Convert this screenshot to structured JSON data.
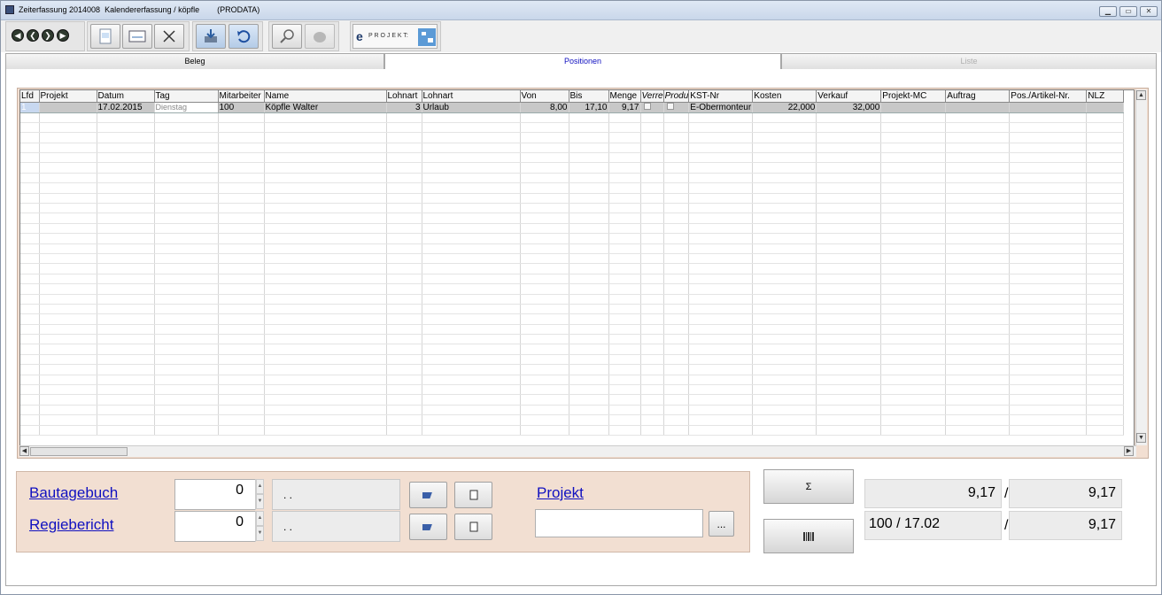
{
  "window": {
    "title": "Zeiterfassung 2014008  Kalendererfassung / köpfle        (PRODATA)",
    "controls": [
      "▁",
      "▭",
      "✕"
    ]
  },
  "toolbar": {
    "nav_glyphs": [
      "◀",
      "❮",
      "❯",
      "▶"
    ],
    "eprojekt_label": "P R O J E K T:",
    "eprojekt_e": "e"
  },
  "tabs": [
    {
      "label": "Beleg",
      "state": "normal"
    },
    {
      "label": "Positionen",
      "state": "active"
    },
    {
      "label": "Liste",
      "state": "disabled"
    }
  ],
  "grid": {
    "columns": [
      "Lfd",
      "Projekt",
      "Datum",
      "Tag",
      "Mitarbeiter",
      "Name",
      "Lohnart",
      "Lohnart",
      "Von",
      "Bis",
      "Menge",
      "Verre",
      "Produ",
      "KST-Nr",
      "Kosten",
      "Verkauf",
      "Projekt-MC",
      "Auftrag",
      "Pos./Artikel-Nr.",
      "NLZ"
    ],
    "italic_columns": [
      11,
      12
    ],
    "rows": [
      [
        "1",
        "",
        "17.02.2015",
        "Dienstag",
        "100",
        "Köpfle Walter",
        "3",
        "Urlaub",
        "8,00",
        "17,10",
        "9,17",
        "",
        "",
        "E-Obermonteur",
        "22,000",
        "32,000",
        "",
        "",
        "",
        ""
      ]
    ],
    "empty_row_count": 32
  },
  "bottom": {
    "bautagebuch_label": "Bautagebuch",
    "regiebericht_label": "Regiebericht",
    "bautagebuch_value": "0",
    "regiebericht_value": "0",
    "bautagebuch_date": ". .",
    "regiebericht_date": ". .",
    "projekt_label": "Projekt",
    "projekt_value": "",
    "browse_label": "..."
  },
  "summary": {
    "sum_button": "Σ",
    "value_top_left": "9,17",
    "value_top_right": "9,17",
    "value_bottom_left": "100 / 17.02",
    "value_bottom_right": "9,17",
    "slash": "/"
  },
  "colors": {
    "panel_bg": "#f2dfd2",
    "link": "#1010c0",
    "selected_row": "#c8c8c8"
  }
}
